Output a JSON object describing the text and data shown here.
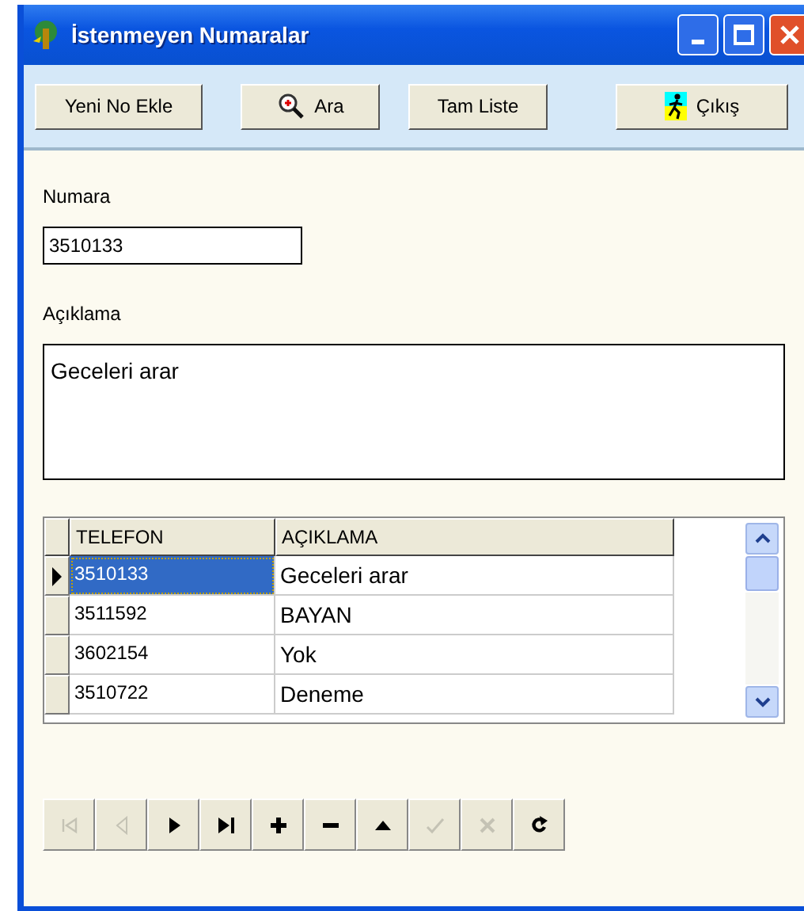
{
  "window": {
    "title": "İstenmeyen Numaralar"
  },
  "toolbar": [
    {
      "label": "Yeni No Ekle",
      "kind": "plain"
    },
    {
      "label": "Ara",
      "kind": "search"
    },
    {
      "label": "Tam Liste",
      "kind": "plain"
    },
    {
      "label": "Çıkış",
      "kind": "exit"
    }
  ],
  "form": {
    "number_label": "Numara",
    "number_value": "3510133",
    "description_label": "Açıklama",
    "description_value": "Geceleri arar"
  },
  "table": {
    "columns": [
      "TELEFON",
      "AÇIKLAMA"
    ],
    "rows": [
      {
        "cells": [
          "3510133",
          "Geceleri arar"
        ],
        "selected": true
      },
      {
        "cells": [
          "3511592",
          "BAYAN"
        ],
        "selected": false
      },
      {
        "cells": [
          "3602154",
          "Yok"
        ],
        "selected": false
      },
      {
        "cells": [
          "3510722",
          "Deneme"
        ],
        "selected": false
      }
    ]
  },
  "navigator": [
    {
      "kind": "first",
      "disabled": true
    },
    {
      "kind": "prior",
      "disabled": true
    },
    {
      "kind": "next",
      "disabled": false
    },
    {
      "kind": "last",
      "disabled": false
    },
    {
      "kind": "insert",
      "disabled": false
    },
    {
      "kind": "delete",
      "disabled": false
    },
    {
      "kind": "edit",
      "disabled": false
    },
    {
      "kind": "post",
      "disabled": true
    },
    {
      "kind": "cancel",
      "disabled": true
    },
    {
      "kind": "refresh",
      "disabled": false
    }
  ]
}
